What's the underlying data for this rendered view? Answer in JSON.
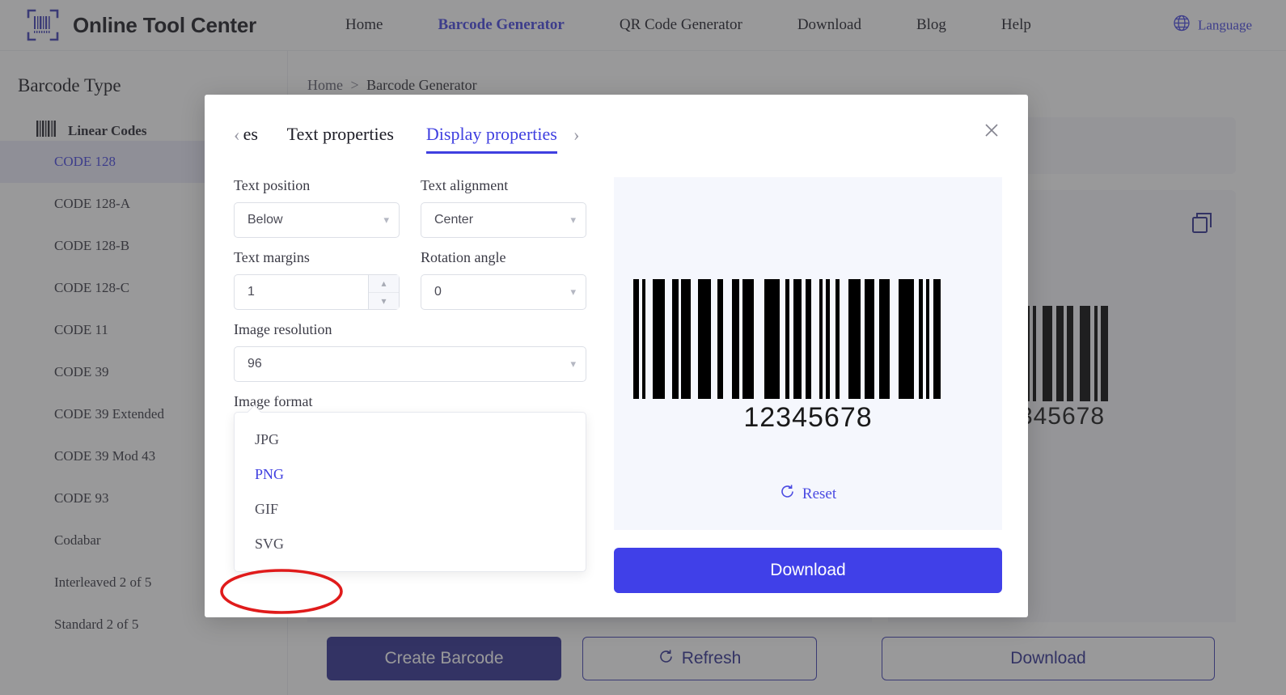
{
  "header": {
    "brand": "Online Tool Center",
    "logo_icon": "barcode-scan-icon",
    "nav": [
      {
        "label": "Home",
        "active": false
      },
      {
        "label": "Barcode Generator",
        "active": true
      },
      {
        "label": "QR Code Generator",
        "active": false
      },
      {
        "label": "Download",
        "active": false
      },
      {
        "label": "Blog",
        "active": false
      },
      {
        "label": "Help",
        "active": false
      }
    ],
    "language": {
      "label": "Language",
      "icon": "globe-icon"
    }
  },
  "sidebar": {
    "title": "Barcode Type",
    "group": {
      "label": "Linear Codes",
      "icon": "barcode-icon"
    },
    "items": [
      {
        "label": "CODE 128",
        "selected": true
      },
      {
        "label": "CODE 128-A",
        "selected": false
      },
      {
        "label": "CODE 128-B",
        "selected": false
      },
      {
        "label": "CODE 128-C",
        "selected": false
      },
      {
        "label": "CODE 11",
        "selected": false
      },
      {
        "label": "CODE 39",
        "selected": false
      },
      {
        "label": "CODE 39 Extended",
        "selected": false
      },
      {
        "label": "CODE 39 Mod 43",
        "selected": false
      },
      {
        "label": "CODE 93",
        "selected": false
      },
      {
        "label": "Codabar",
        "selected": false
      },
      {
        "label": "Interleaved 2 of 5",
        "selected": false
      },
      {
        "label": "Standard 2 of 5",
        "selected": false
      }
    ]
  },
  "breadcrumb": {
    "home": "Home",
    "separator": ">",
    "current": "Barcode Generator"
  },
  "background": {
    "copy_icon": "copy-icon",
    "barcode_number": "345678"
  },
  "bottom_bar": {
    "create": "Create Barcode",
    "refresh": "Refresh",
    "refresh_icon": "refresh-icon",
    "download": "Download"
  },
  "modal": {
    "close_icon": "close-icon",
    "prev_icon": "chevron-left-icon",
    "next_icon": "chevron-right-icon",
    "tabs": [
      {
        "label": "es",
        "active": false,
        "clipped": true
      },
      {
        "label": "Text properties",
        "active": false,
        "clipped": false
      },
      {
        "label": "Display properties",
        "active": true,
        "clipped": false
      }
    ],
    "fields": {
      "text_position": {
        "label": "Text position",
        "value": "Below",
        "icon": "chevron-down-icon"
      },
      "text_alignment": {
        "label": "Text alignment",
        "value": "Center",
        "icon": "chevron-down-icon"
      },
      "text_margins": {
        "label": "Text margins",
        "value": "1",
        "up_icon": "chevron-up-icon",
        "down_icon": "chevron-down-icon"
      },
      "rotation_angle": {
        "label": "Rotation angle",
        "value": "0",
        "icon": "chevron-down-icon"
      },
      "image_resolution": {
        "label": "Image resolution",
        "value": "96",
        "icon": "chevron-down-icon"
      },
      "image_format": {
        "label": "Image format",
        "value": "PNG",
        "icon": "chevron-up-icon",
        "open": true
      }
    },
    "format_options": [
      {
        "label": "JPG",
        "selected": false
      },
      {
        "label": "PNG",
        "selected": true
      },
      {
        "label": "GIF",
        "selected": false
      },
      {
        "label": "SVG",
        "selected": false,
        "annotated": true
      }
    ],
    "preview": {
      "barcode_number": "12345678",
      "reset_label": "Reset",
      "reset_icon": "refresh-icon",
      "download_label": "Download"
    }
  },
  "colors": {
    "accent": "#3f3fe0",
    "accent_button": "#4040e8",
    "primary_dark": "#2a2a8f",
    "annotation": "#e01b1b",
    "preview_bg": "#f5f7fd"
  }
}
